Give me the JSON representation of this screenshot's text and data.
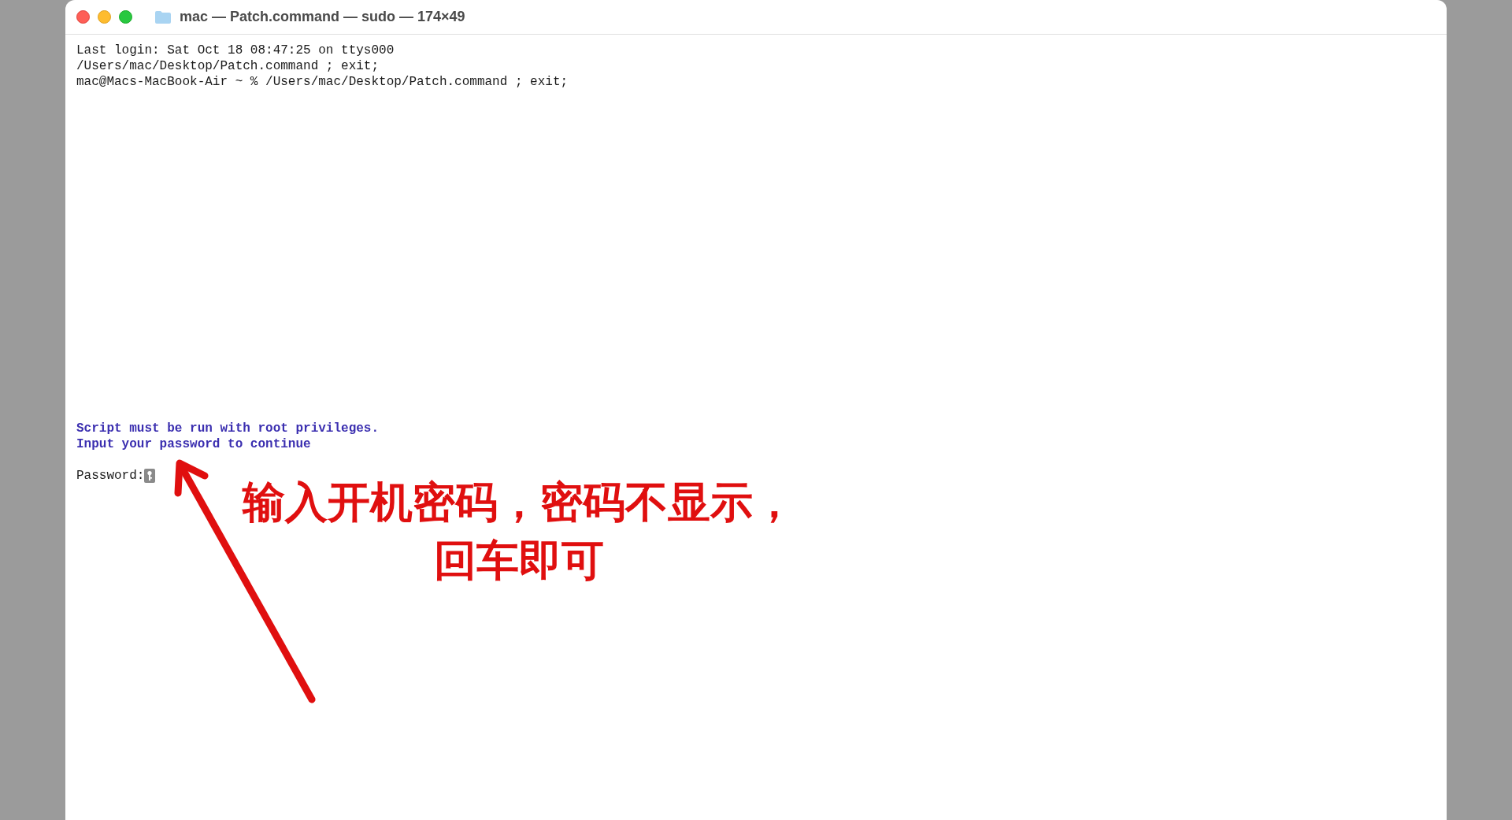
{
  "window": {
    "title": "mac — Patch.command — sudo — 174×49"
  },
  "terminal": {
    "lines": [
      {
        "text": "Last login: Sat Oct 18 08:47:25 on ttys000",
        "kind": "plain"
      },
      {
        "text": "/Users/mac/Desktop/Patch.command ; exit;",
        "kind": "plain"
      },
      {
        "text": "mac@Macs-MacBook-Air ~ % /Users/mac/Desktop/Patch.command ; exit;",
        "kind": "plain"
      }
    ],
    "notice_lines": [
      {
        "text": "Script must be run with root privileges.",
        "kind": "notice"
      },
      {
        "text": "Input your password to continue",
        "kind": "notice"
      }
    ],
    "prompt": "Password:"
  },
  "annotation": {
    "lines": [
      "输入开机密码，密码不显示，",
      "回车即可"
    ]
  }
}
